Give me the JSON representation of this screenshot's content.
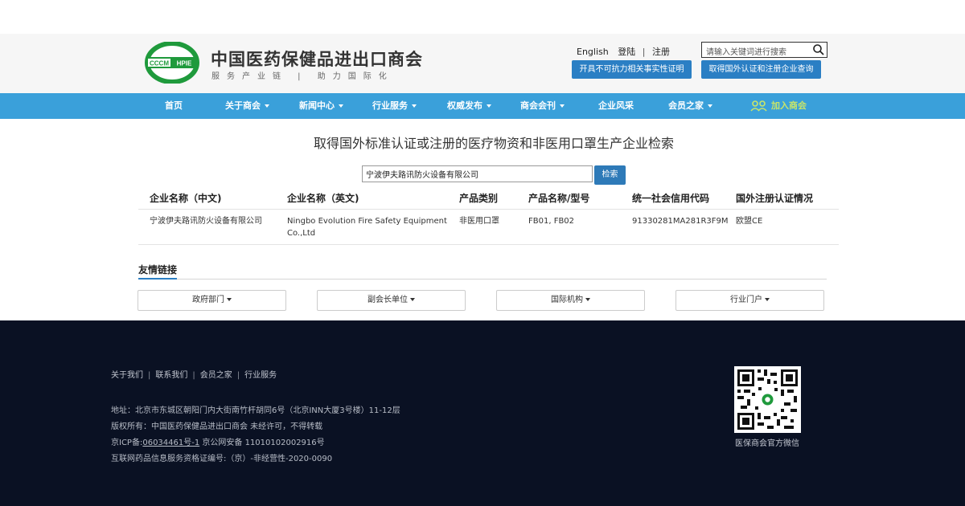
{
  "header": {
    "logo_text": "CCCM HPIE",
    "org_name": "中国医药保健品进出口商会",
    "slogan": "服务产业链 | 助力国际化",
    "english_link": "English",
    "login_link": "登陆",
    "register_link": "注册",
    "search_placeholder": "请输入关键词进行搜索",
    "button_certificate": "开具不可抗力相关事实性证明",
    "button_query": "取得国外认证和注册企业查询"
  },
  "nav": {
    "items": [
      {
        "label": "首页"
      },
      {
        "label": "关于商会"
      },
      {
        "label": "新闻中心"
      },
      {
        "label": "行业服务"
      },
      {
        "label": "权威发布"
      },
      {
        "label": "商会会刊"
      },
      {
        "label": "企业风采"
      },
      {
        "label": "会员之家"
      }
    ],
    "join_label": "加入商会"
  },
  "main": {
    "title": "取得国外标准认证或注册的医疗物资和非医用口罩生产企业检索",
    "search_value": "宁波伊夫路讯防火设备有限公司",
    "search_button": "检索",
    "table": {
      "headers": [
        "企业名称（中文)",
        "企业名称（英文)",
        "产品类别",
        "产品名称/型号",
        "统一社会信用代码",
        "国外注册认证情况"
      ],
      "rows": [
        [
          "宁波伊夫路讯防火设备有限公司",
          "Ningbo Evolution Fire Safety Equipment Co.,Ltd",
          "非医用口罩",
          "FB01, FB02",
          "91330281MA281R3F9M",
          "欧盟CE"
        ]
      ]
    }
  },
  "friend_links": {
    "title": "友情链接",
    "dropdowns": [
      {
        "label": "政府部门"
      },
      {
        "label": "副会长单位"
      },
      {
        "label": "国际机构"
      },
      {
        "label": "行业门户"
      }
    ]
  },
  "footer": {
    "links": [
      {
        "label": "关于我们"
      },
      {
        "label": "联系我们"
      },
      {
        "label": "会员之家"
      },
      {
        "label": "行业服务"
      }
    ],
    "address": "地址：北京市东城区朝阳门内大街南竹杆胡同6号（北京INN大厦3号楼）11-12层",
    "copyright": "版权所有：中国医药保健品进出口商会 未经许可，不得转载",
    "icp_prefix": "京ICP备:",
    "icp_link": "06034461号-1",
    "icp_suffix": " 京公网安备 11010102002916号",
    "license": "互联网药品信息服务资格证编号:（京）-非经营性-2020-0090",
    "qr_caption": "医保商会官方微信"
  },
  "colors": {
    "nav_bar": "#3aa0da",
    "button_blue": "#2b7fc4",
    "join_green": "#c8e56a",
    "logo_green": "#1f9a3c",
    "footer_bg": "#0a1123"
  },
  "icons": {
    "search": "search-icon",
    "join": "people-icon",
    "logo": "cccmhpie-logo",
    "qr": "wechat-qr-code"
  }
}
